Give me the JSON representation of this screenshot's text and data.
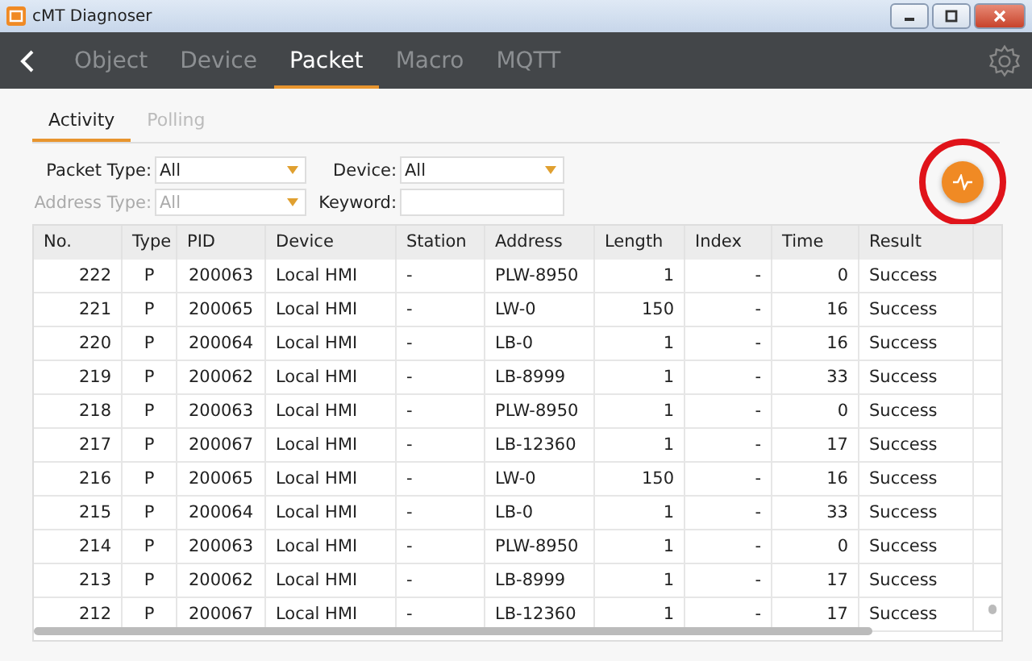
{
  "window": {
    "title": "cMT Diagnoser"
  },
  "tabs": [
    {
      "label": "Object",
      "selected": false
    },
    {
      "label": "Device",
      "selected": false
    },
    {
      "label": "Packet",
      "selected": true
    },
    {
      "label": "Macro",
      "selected": false
    },
    {
      "label": "MQTT",
      "selected": false
    }
  ],
  "sub_tabs": [
    {
      "label": "Activity",
      "selected": true
    },
    {
      "label": "Polling",
      "selected": false
    }
  ],
  "filters": [
    {
      "kind": "dropdown",
      "label": "Packet Type:",
      "value": "All",
      "disabled": false
    },
    {
      "kind": "dropdown",
      "label": "Device:",
      "value": "All",
      "disabled": false
    },
    {
      "kind": "dropdown",
      "label": "Address Type:",
      "value": "All",
      "disabled": true
    },
    {
      "kind": "text",
      "label": "Keyword:",
      "disabled": false
    }
  ],
  "table": {
    "columns": [
      "No.",
      "Type",
      "PID",
      "Device",
      "Station",
      "Address",
      "Length",
      "Index",
      "Time",
      "Result"
    ],
    "rows": [
      [
        "222",
        "P",
        "200063",
        "Local HMI",
        "-",
        "PLW-8950",
        "1",
        "-",
        "0",
        "Success"
      ],
      [
        "221",
        "P",
        "200065",
        "Local HMI",
        "-",
        "LW-0",
        "150",
        "-",
        "16",
        "Success"
      ],
      [
        "220",
        "P",
        "200064",
        "Local HMI",
        "-",
        "LB-0",
        "1",
        "-",
        "16",
        "Success"
      ],
      [
        "219",
        "P",
        "200062",
        "Local HMI",
        "-",
        "LB-8999",
        "1",
        "-",
        "33",
        "Success"
      ],
      [
        "218",
        "P",
        "200063",
        "Local HMI",
        "-",
        "PLW-8950",
        "1",
        "-",
        "0",
        "Success"
      ],
      [
        "217",
        "P",
        "200067",
        "Local HMI",
        "-",
        "LB-12360",
        "1",
        "-",
        "17",
        "Success"
      ],
      [
        "216",
        "P",
        "200065",
        "Local HMI",
        "-",
        "LW-0",
        "150",
        "-",
        "16",
        "Success"
      ],
      [
        "215",
        "P",
        "200064",
        "Local HMI",
        "-",
        "LB-0",
        "1",
        "-",
        "33",
        "Success"
      ],
      [
        "214",
        "P",
        "200063",
        "Local HMI",
        "-",
        "PLW-8950",
        "1",
        "-",
        "0",
        "Success"
      ],
      [
        "213",
        "P",
        "200062",
        "Local HMI",
        "-",
        "LB-8999",
        "1",
        "-",
        "17",
        "Success"
      ],
      [
        "212",
        "P",
        "200067",
        "Local HMI",
        "-",
        "LB-12360",
        "1",
        "-",
        "17",
        "Success"
      ]
    ]
  }
}
